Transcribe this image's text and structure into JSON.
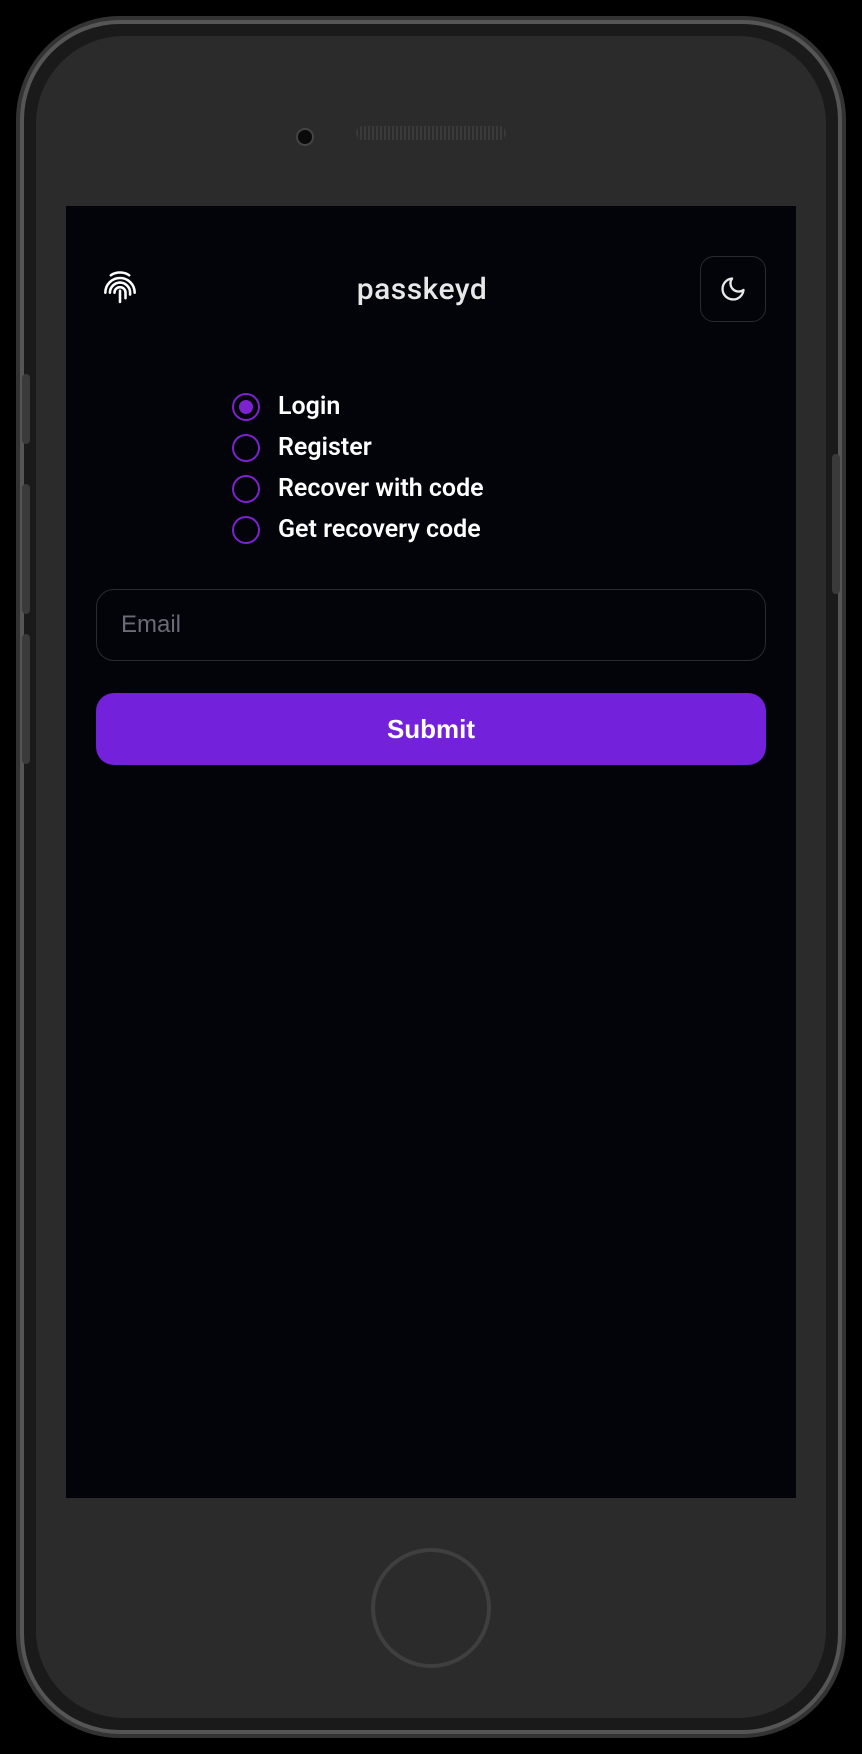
{
  "app": {
    "title": "passkeyd"
  },
  "radioOptions": {
    "login": "Login",
    "register": "Register",
    "recover": "Recover with code",
    "getCode": "Get recovery code",
    "selected": "login"
  },
  "form": {
    "emailPlaceholder": "Email",
    "emailValue": "",
    "submitLabel": "Submit"
  },
  "colors": {
    "accent": "#7421db",
    "radioBorder": "#7c22ce",
    "background": "#02040a"
  }
}
